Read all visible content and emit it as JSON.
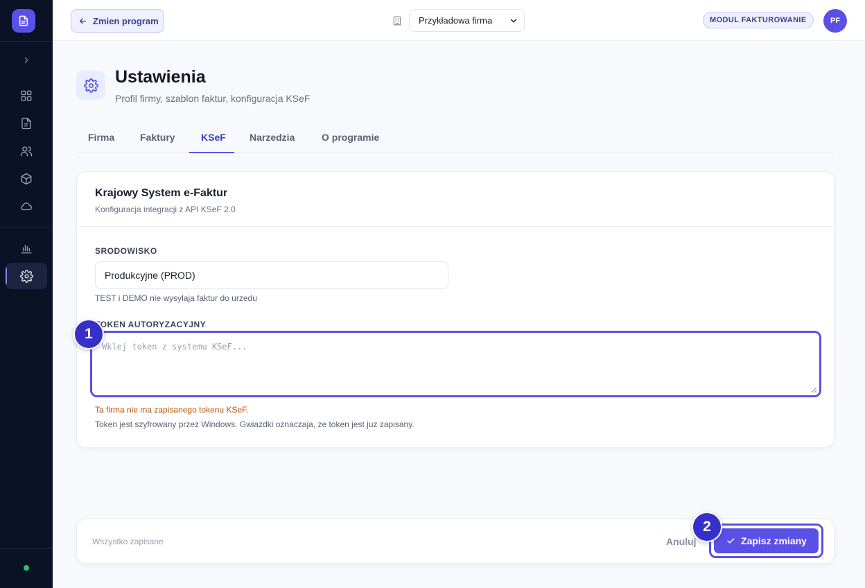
{
  "sidebar": {
    "logo_icon": "document-icon",
    "expand_icon": "chevron-right-icon",
    "nav_icons": [
      "dashboard-icon",
      "document-icon",
      "users-icon",
      "box-icon",
      "cloud-icon",
      "chart-icon",
      "gear-icon"
    ],
    "active_item": "gear-icon",
    "status_color": "#22c55e"
  },
  "topbar": {
    "back_label": "Zmien program",
    "company_select_value": "Przykładowa firma",
    "module_badge": "MODUL FAKTUROWANIE",
    "avatar_initials": "PF"
  },
  "page": {
    "title": "Ustawienia",
    "subtitle": "Profil firmy, szablon faktur, konfiguracja KSeF"
  },
  "tabs": [
    {
      "label": "Firma",
      "active": false
    },
    {
      "label": "Faktury",
      "active": false
    },
    {
      "label": "KSeF",
      "active": true
    },
    {
      "label": "Narzedzia",
      "active": false
    },
    {
      "label": "O programie",
      "active": false
    }
  ],
  "card": {
    "title": "Krajowy System e-Faktur",
    "subtitle": "Konfiguracja integracji z API KSeF 2.0",
    "environment_label": "SRODOWISKO",
    "environment_value": "Produkcyjne (PROD)",
    "environment_hint": "TEST i DEMO nie wysylaja faktur do urzedu",
    "token_label": "TOKEN AUTORYZACYJNY",
    "token_placeholder": "Wklej token z systemu KSeF...",
    "token_warning": "Ta firma nie ma zapisanego tokenu KSeF.",
    "token_hint": "Token jest szyfrowany przez Windows. Gwiazdki oznaczaja, ze token jest juz zapisany."
  },
  "footer": {
    "status": "Wszystko zapisane",
    "cancel_label": "Anuluj",
    "save_label": "Zapisz zmiany"
  },
  "markers": [
    "1",
    "2"
  ],
  "colors": {
    "accent": "#5b50e6",
    "sidebar_bg": "#0b1226",
    "warning": "#b45309"
  }
}
